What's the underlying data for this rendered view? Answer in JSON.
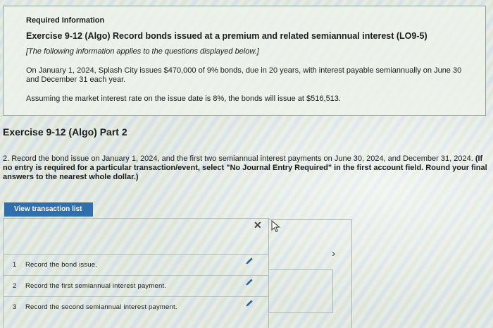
{
  "info": {
    "title": "Required Information",
    "exercise_title": "Exercise 9-12 (Algo) Record bonds issued at a premium and related semiannual interest (LO9-5)",
    "note": "[The following information applies to the questions displayed below.]",
    "paragraph1": "On January 1, 2024, Splash City issues $470,000 of 9% bonds, due in 20 years, with interest payable semiannually on June 30 and December 31 each year.",
    "paragraph2": "Assuming the market interest rate on the issue date is 8%, the bonds will issue at $516,513."
  },
  "part_title": "Exercise 9-12 (Algo) Part 2",
  "question": {
    "text": "2. Record the bond issue on January 1, 2024, and the first two semiannual interest payments on June 30, 2024, and December 31, 2024.",
    "instruction": "(If no entry is required for a particular transaction/event, select \"No Journal Entry Required\" in the first account field. Round your final answers to the nearest whole dollar.)"
  },
  "view_button_label": "View transaction list",
  "close_glyph": "✕",
  "chevron_glyph": "›",
  "transactions": [
    {
      "num": "1",
      "label": "Record the bond issue."
    },
    {
      "num": "2",
      "label": "Record the first semiannual interest payment."
    },
    {
      "num": "3",
      "label": "Record the second semiannual interest payment."
    }
  ],
  "colors": {
    "button": "#2f6fad",
    "pencil": "#2a5f93"
  },
  "icons": [
    "close-icon",
    "mouse-cursor-icon",
    "chevron-right-icon",
    "pencil-icon"
  ]
}
